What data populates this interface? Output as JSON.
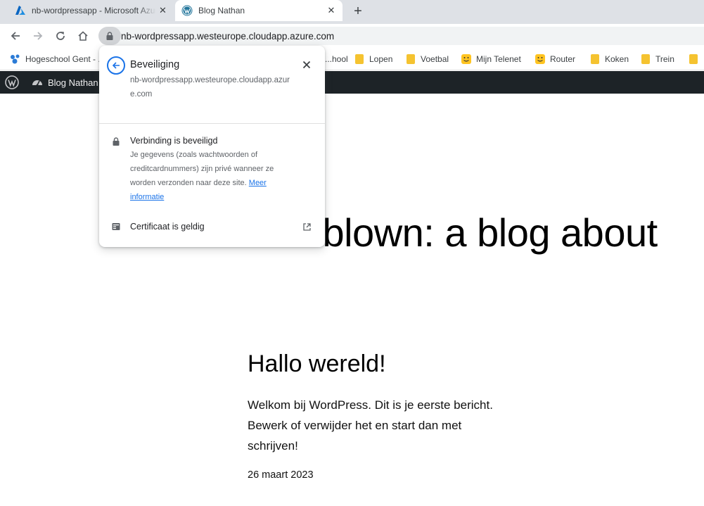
{
  "tabs": [
    {
      "title": "nb-wordpressapp - Microsoft Azure",
      "favicon": "azure-logo-icon",
      "active": false
    },
    {
      "title": "Blog Nathan",
      "favicon": "wordpress-logo-icon",
      "active": true
    }
  ],
  "toolbar": {
    "url": "nb-wordpressapp.westeurope.cloudapp.azure.com"
  },
  "bookmarks": [
    {
      "label": "Hogeschool Gent - ...",
      "icon": "hogent-icon"
    },
    {
      "label": "...hool",
      "icon": "folder-icon"
    },
    {
      "label": "Lopen",
      "icon": "folder-icon"
    },
    {
      "label": "Voetbal",
      "icon": "folder-icon"
    },
    {
      "label": "Mijn Telenet",
      "icon": "telenet-icon"
    },
    {
      "label": "Router",
      "icon": "telenet-icon"
    },
    {
      "label": "Koken",
      "icon": "folder-icon"
    },
    {
      "label": "Trein",
      "icon": "folder-icon"
    }
  ],
  "adminbar": {
    "site_name": "Blog Nathan"
  },
  "page": {
    "hero": "...ndblown: a blog about",
    "post_title": "Hallo wereld!",
    "post_excerpt": "Welkom bij WordPress. Dit is je eerste bericht. Bewerk of verwijder het en start dan met schrijven!",
    "post_date": "26 maart 2023"
  },
  "popup": {
    "title": "Beveiliging",
    "host": "nb-wordpressapp.westeurope.cloudapp.azure.com",
    "connection_heading": "Verbinding is beveiligd",
    "connection_desc": "Je gegevens (zoals wachtwoorden of creditcardnummers) zijn privé wanneer ze worden verzonden naar deze site.",
    "more_info": "Meer informatie",
    "certificate": "Certificaat is geldig"
  },
  "colors": {
    "accent": "#1a73e8",
    "adminbar": "#1d2327",
    "tabstrip": "#dee1e6",
    "folder": "#f5c330"
  }
}
